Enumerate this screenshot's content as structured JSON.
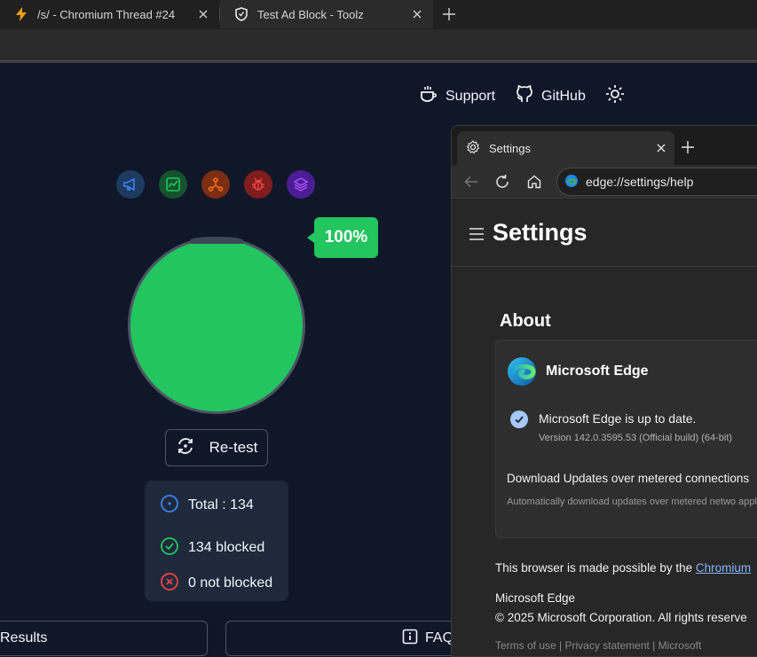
{
  "browser": {
    "tabs": [
      {
        "title": "/s/ - Chromium Thread #24",
        "icon": "lightning-icon"
      },
      {
        "title": "Test Ad Block - Toolz",
        "icon": "shield-icon"
      }
    ]
  },
  "page": {
    "nav": {
      "support": "Support",
      "github": "GitHub"
    },
    "result_percent": "100%",
    "retest_label": "Re-test",
    "stats": {
      "total": "Total : 134",
      "blocked": "134 blocked",
      "not_blocked": "0 not blocked"
    },
    "bottom": {
      "results": "Results",
      "faq": "FAQ"
    },
    "colors": {
      "success": "#22c55e",
      "danger": "#ef4444",
      "info": "#3b82f6"
    }
  },
  "edge_window": {
    "tab_title": "Settings",
    "address": "edge://settings/help",
    "page_title": "Settings",
    "section": "About",
    "product": "Microsoft Edge",
    "status": "Microsoft Edge is up to date.",
    "version": "Version 142.0.3595.53 (Official build) (64-bit)",
    "metered_title": "Download Updates over metered connections",
    "metered_desc": "Automatically download updates over metered netwo apply.",
    "made_possible_prefix": "This browser is made possible by the",
    "chromium_link": "Chromium",
    "footer_product": "Microsoft Edge",
    "copyright": "© 2025 Microsoft Corporation. All rights reserve",
    "footer_links": "Terms of use | Privacy statement | Microsoft"
  }
}
